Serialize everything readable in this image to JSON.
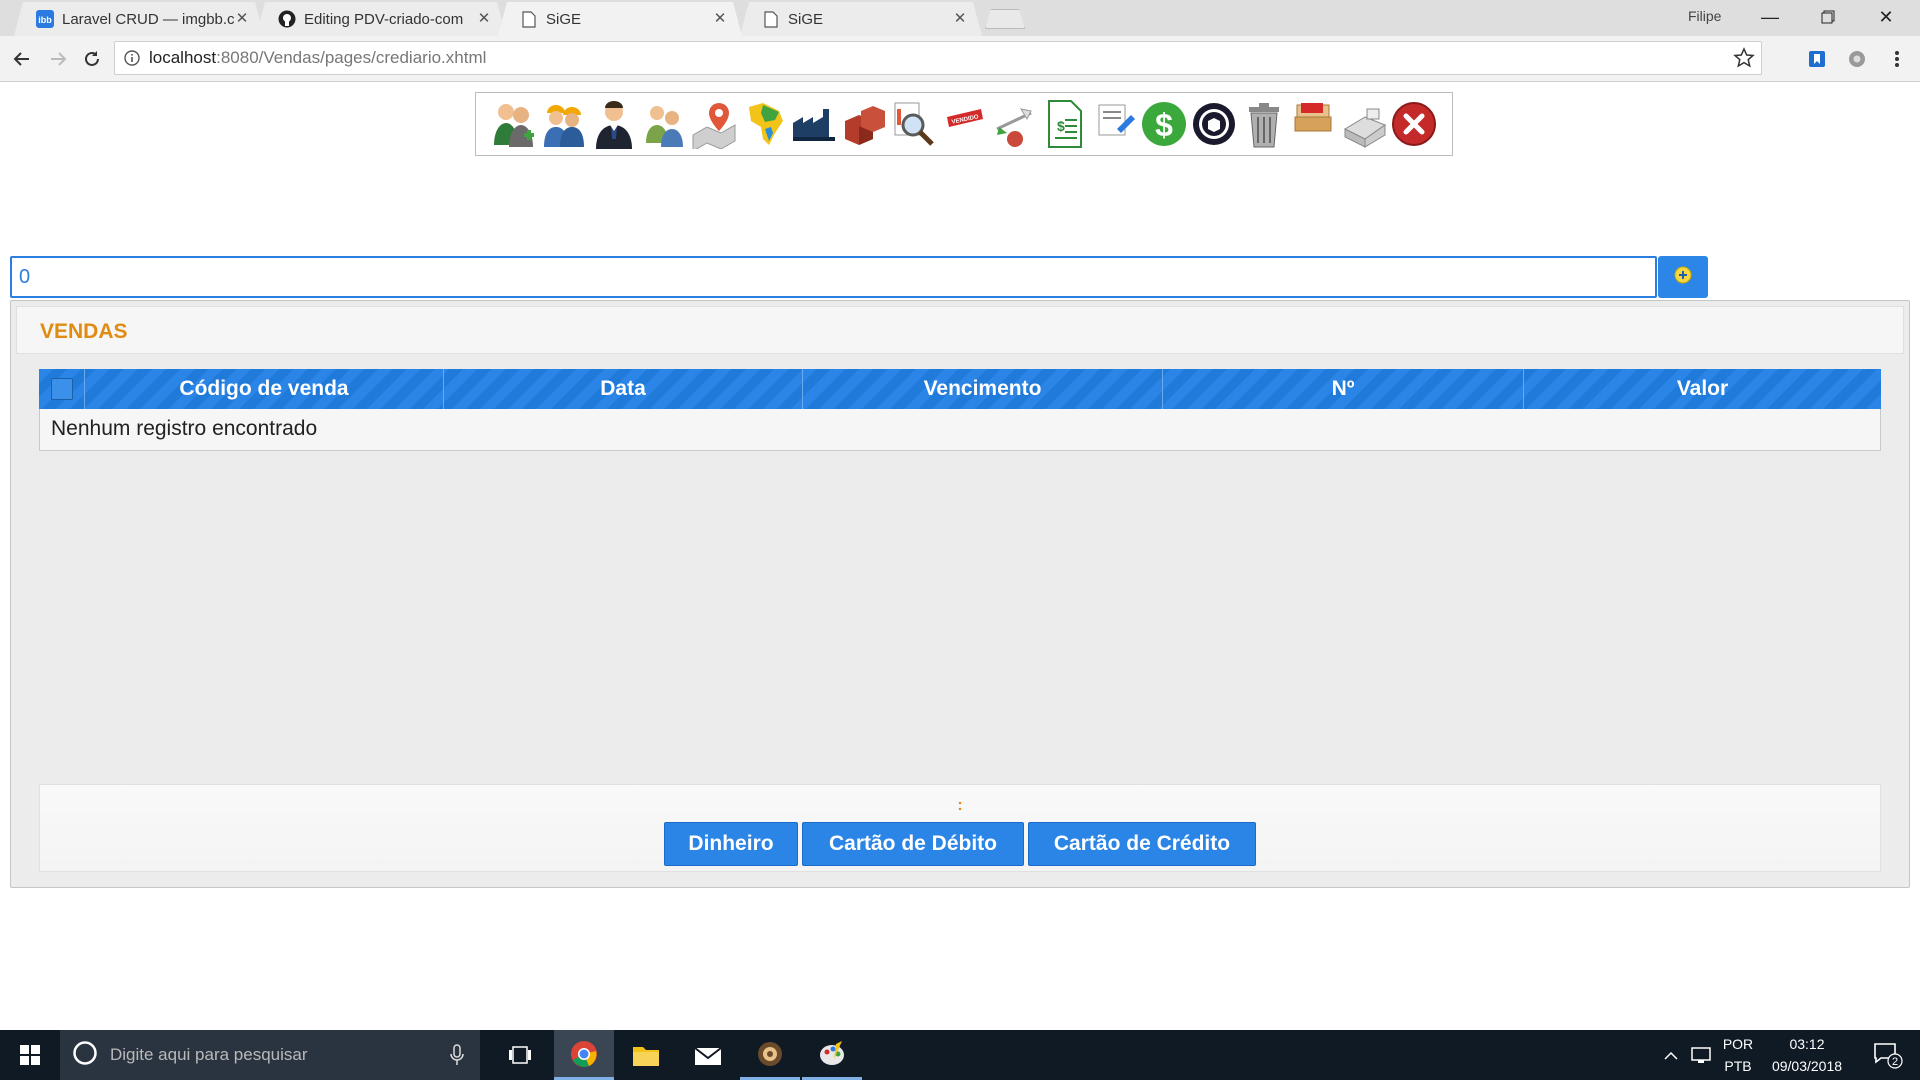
{
  "browser": {
    "tabs": [
      {
        "title": "Laravel CRUD — imgbb.c",
        "icon": "imgbb-icon"
      },
      {
        "title": "Editing PDV-criado-com",
        "icon": "github-icon"
      },
      {
        "title": "SiGE",
        "icon": "page-icon"
      },
      {
        "title": "SiGE",
        "icon": "page-icon"
      }
    ],
    "user": "Filipe",
    "url_host": "localhost",
    "url_rest": ":8080/Vendas/pages/crediario.xhtml"
  },
  "toolbar_icons": [
    "clients-icon",
    "workers-icon",
    "manager-icon",
    "users-icon",
    "map-pin-icon",
    "brazil-map-icon",
    "factory-icon",
    "boxes-icon",
    "search-report-icon",
    "sold-tag-icon",
    "scale-icon",
    "invoice-icon",
    "pen-report-icon",
    "dollar-icon",
    "package-icon",
    "trash-icon",
    "drawer-icon",
    "cash-register-icon",
    "exit-icon"
  ],
  "search": {
    "value": "0"
  },
  "panel": {
    "title": "VENDAS",
    "columns": [
      "Código de venda",
      "Data",
      "Vencimento",
      "Nº",
      "Valor"
    ],
    "empty_message": "Nenhum registro encontrado"
  },
  "footer": {
    "colon": ":",
    "buttons": [
      "Dinheiro",
      "Cartão de Débito",
      "Cartão de Crédito"
    ]
  },
  "taskbar": {
    "search_placeholder": "Digite aqui para pesquisar",
    "lang_top": "POR",
    "lang_bottom": "PTB",
    "time": "03:12",
    "date": "09/03/2018",
    "notifications": "2"
  }
}
